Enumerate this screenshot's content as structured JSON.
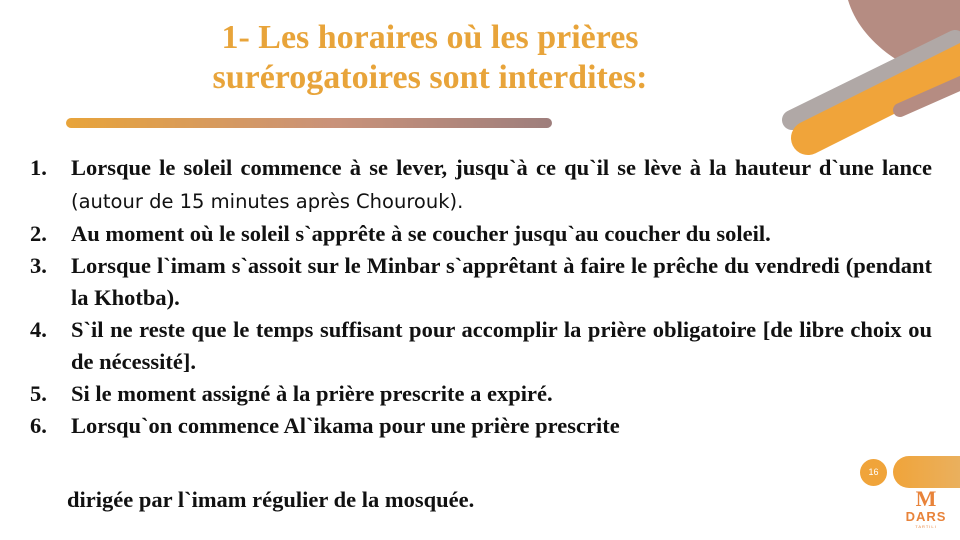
{
  "title": {
    "line1": "1- Les horaires où les prières",
    "line2": "surérogatoires sont interdites:"
  },
  "items": [
    {
      "num": "1.",
      "bold": "Lorsque le soleil commence à se lever, jusqu`à ce qu`il se lève à la hauteur d`une lance",
      "note": " (autour de 15 minutes après Chourouk)."
    },
    {
      "num": "2.",
      "bold": "Au moment où le soleil s`apprête à se coucher jusqu`au coucher du soleil.",
      "note": ""
    },
    {
      "num": "3.",
      "bold": "Lorsque l`imam s`assoit sur le Minbar s`apprêtant à faire le prêche du vendredi (pendant la Khotba).",
      "note": ""
    },
    {
      "num": "4.",
      "bold": "S`il ne reste que le temps suffisant pour accomplir la prière obligatoire [de libre choix ou de nécessité].",
      "note": ""
    },
    {
      "num": "5.",
      "bold": "Si le moment assigné à la prière prescrite a expiré.",
      "note": ""
    },
    {
      "num": "6.",
      "bold": "Lorsqu`on commence Al`ikama pour une prière prescrite",
      "note": ""
    }
  ],
  "continuation": "dirigée par l`imam régulier de la mosquée.",
  "page_number": "16",
  "logo": {
    "mark": "M",
    "word": "DARS",
    "sub": "TARTILI"
  },
  "colors": {
    "accent": "#E8A43A",
    "mauve": "#B58C82",
    "text": "#111111"
  }
}
